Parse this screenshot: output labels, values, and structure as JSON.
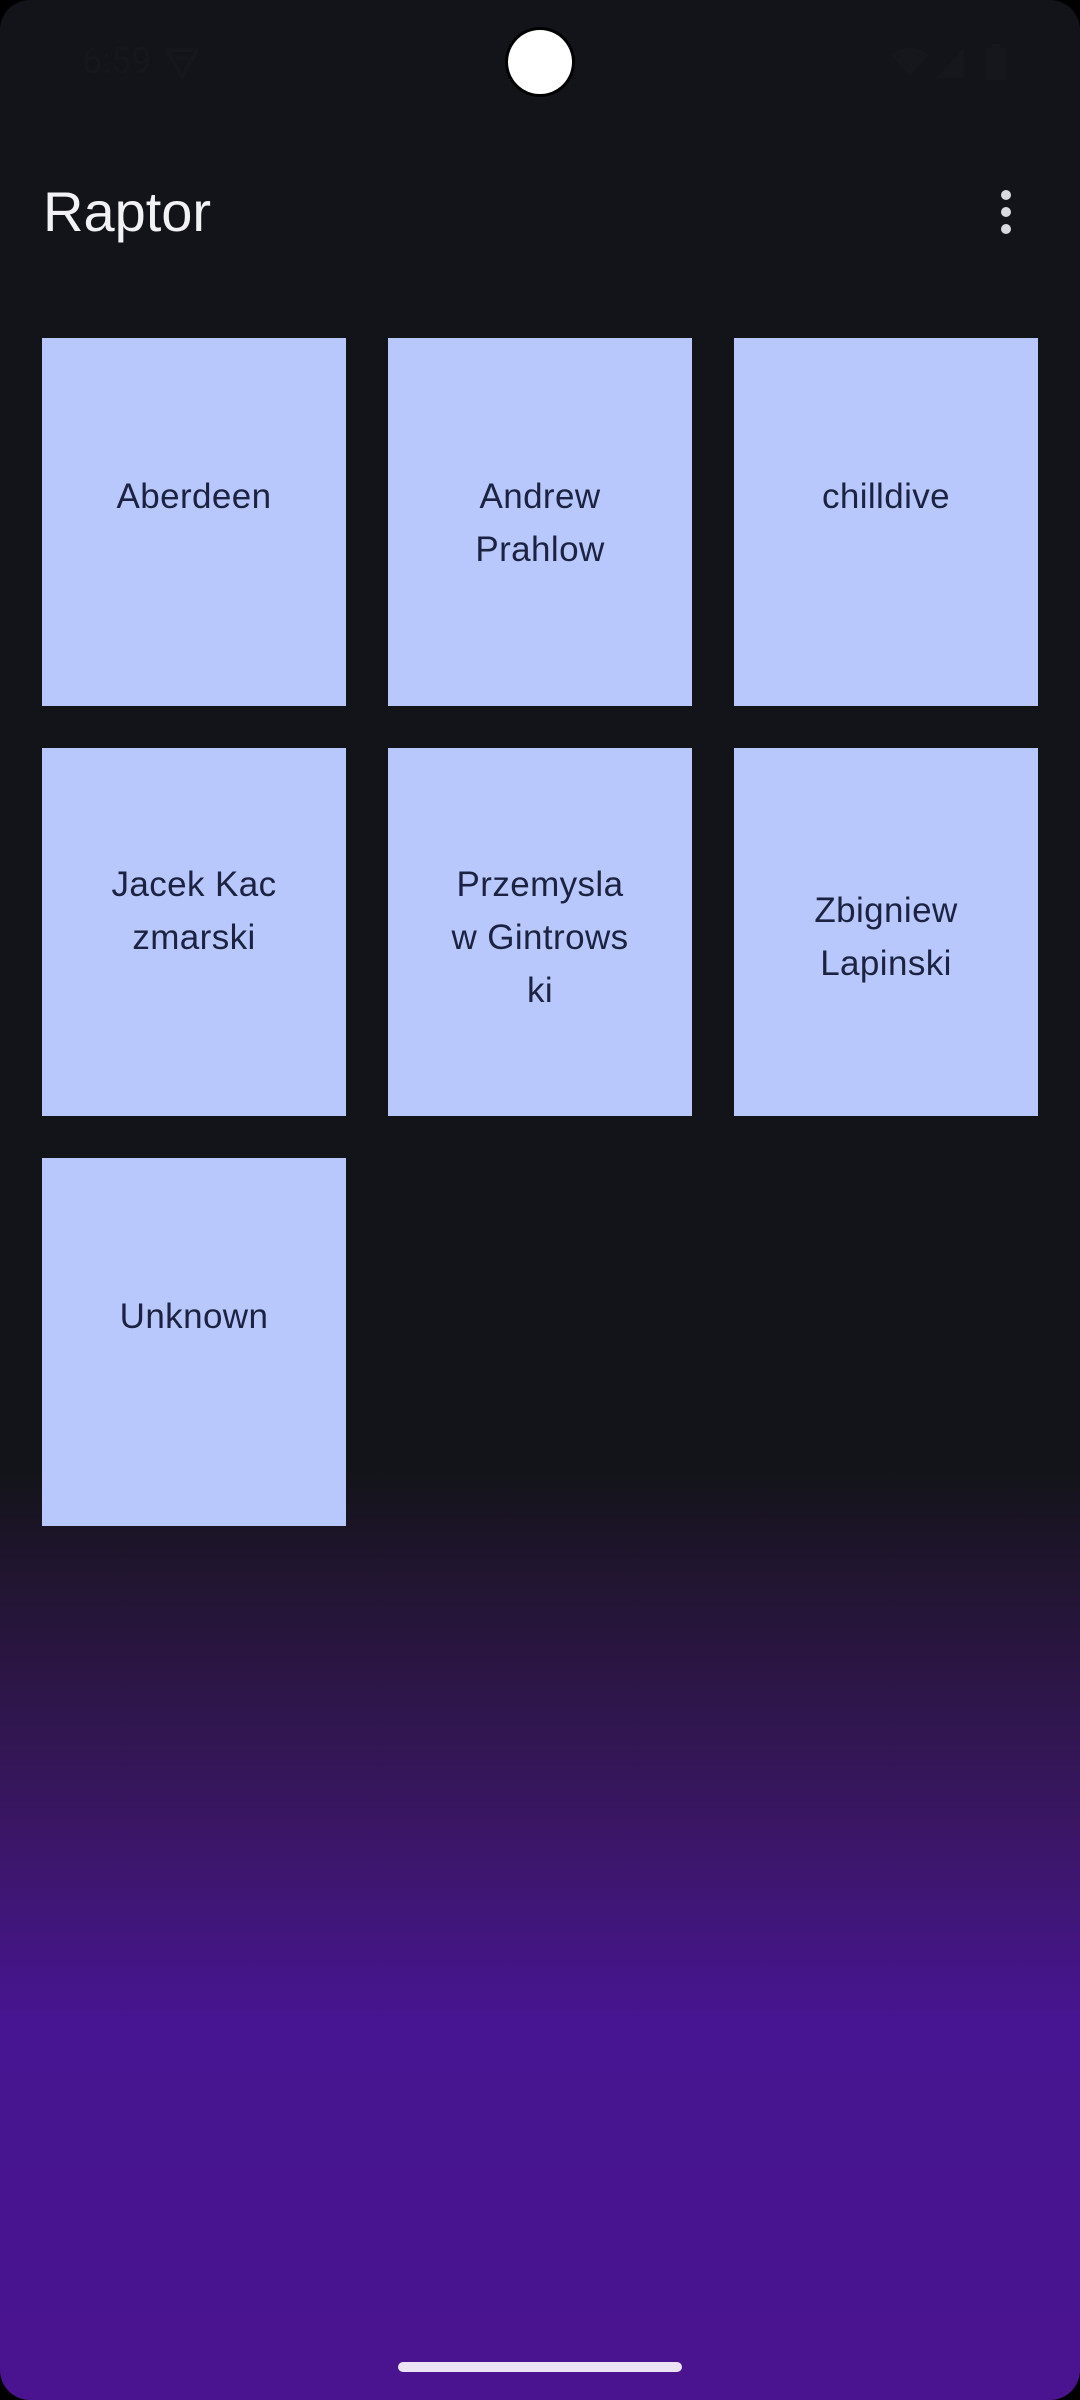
{
  "status_bar": {
    "time": "6:59",
    "icons": [
      "vpn-key-icon",
      "wifi-icon",
      "cell-signal-icon",
      "battery-icon"
    ]
  },
  "app_bar": {
    "title": "Raptor",
    "menu_icon": "more-vert-icon"
  },
  "artists": [
    {
      "label": "Aberdeen"
    },
    {
      "label": "Andrew Prahlow"
    },
    {
      "label": "chilldive"
    },
    {
      "label": "Jacek Kaczmarski"
    },
    {
      "label": "Przemyslaw Gintrowski"
    },
    {
      "label": "Zbigniew Lapinski"
    },
    {
      "label": "Unknown"
    }
  ],
  "colors": {
    "background_top": "#131419",
    "background_bottom": "#4a1490",
    "tile": "#b8c8fc",
    "tile_text": "#1c2240",
    "title_text": "#f2f2f5"
  }
}
